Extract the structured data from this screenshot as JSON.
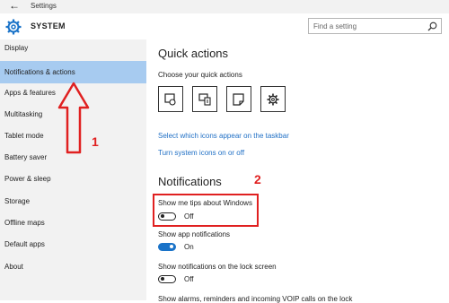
{
  "window": {
    "title": "Settings"
  },
  "header": {
    "section": "SYSTEM",
    "search_placeholder": "Find a setting"
  },
  "sidebar": {
    "items": [
      {
        "label": "Display"
      },
      {
        "label": "Notifications & actions",
        "selected": true
      },
      {
        "label": "Apps & features"
      },
      {
        "label": "Multitasking"
      },
      {
        "label": "Tablet mode"
      },
      {
        "label": "Battery saver"
      },
      {
        "label": "Power & sleep"
      },
      {
        "label": "Storage"
      },
      {
        "label": "Offline maps"
      },
      {
        "label": "Default apps"
      },
      {
        "label": "About"
      }
    ]
  },
  "quick_actions": {
    "title": "Quick actions",
    "subtitle": "Choose your quick actions",
    "buttons": [
      {
        "icon": "tablet-mode-icon"
      },
      {
        "icon": "connect-icon"
      },
      {
        "icon": "note-icon"
      },
      {
        "icon": "settings-gear-icon"
      }
    ],
    "link_taskbar": "Select which icons appear on the taskbar",
    "link_system_icons": "Turn system icons on or off"
  },
  "notifications": {
    "title": "Notifications",
    "tips": {
      "label": "Show me tips about Windows",
      "state": "Off"
    },
    "app_notifications": {
      "label": "Show app notifications",
      "state": "On"
    },
    "lock_screen": {
      "label": "Show notifications on the lock screen",
      "state": "Off"
    },
    "alarms": {
      "label": "Show alarms, reminders and incoming VOIP calls on the lock"
    }
  },
  "annotations": {
    "label1": "1",
    "label2": "2",
    "color": "#e02020"
  },
  "colors": {
    "accent": "#1a73c8",
    "selected_bg": "#a7cbf0",
    "link": "#1f6fc5"
  }
}
